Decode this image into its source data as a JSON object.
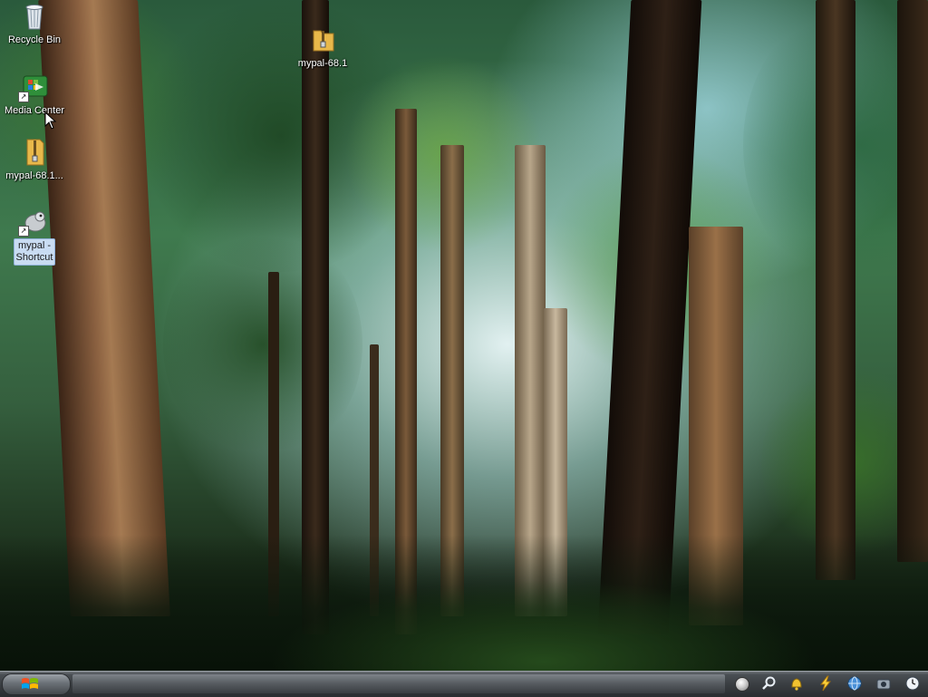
{
  "desktop": {
    "icons": [
      {
        "label": "Recycle Bin",
        "icon": "recycle-bin-icon"
      },
      {
        "label": "Media Center",
        "icon": "media-center-icon"
      },
      {
        "label": "mypal-68.1...",
        "icon": "zip-folder-icon"
      },
      {
        "label": "mypal -\nShortcut",
        "icon": "mypal-app-icon"
      },
      {
        "label": "mypal-68.1",
        "icon": "zip-folder-icon"
      }
    ]
  },
  "taskbar": {
    "start_icon": "windows-start-orb-icon",
    "tray_icons": [
      "circle-icon",
      "search-icon",
      "bell-icon",
      "lightning-icon",
      "network-globe-icon",
      "camera-icon",
      "clock-icon"
    ]
  },
  "colors": {
    "taskbar_bg": "#3a3e42",
    "selection_bg": "#c9dcf2",
    "forest_light": "#e6f4f4",
    "forest_dark": "#0c160c"
  }
}
